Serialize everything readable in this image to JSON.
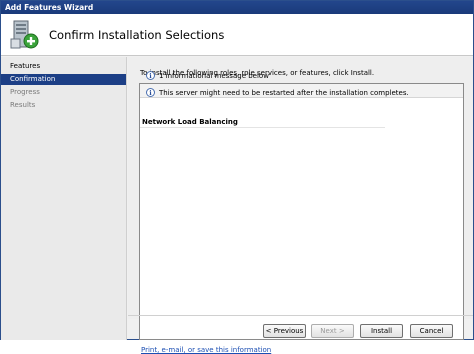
{
  "window": {
    "title": "Add Features Wizard"
  },
  "header": {
    "title": "Confirm Installation Selections",
    "icon": "server-add-icon"
  },
  "sidebar": {
    "items": [
      {
        "label": "Features",
        "state": "normal"
      },
      {
        "label": "Confirmation",
        "state": "active"
      },
      {
        "label": "Progress",
        "state": "disabled"
      },
      {
        "label": "Results",
        "state": "disabled"
      }
    ]
  },
  "main": {
    "instruction": "To install the following roles, role services, or features, click Install.",
    "summary": "1 informational message below",
    "restart_notice": "This server might need to be restarted after the installation completes.",
    "feature": "Network Load Balancing",
    "link": "Print, e-mail, or save this information"
  },
  "buttons": {
    "previous": "< Previous",
    "next": "Next >",
    "install": "Install",
    "cancel": "Cancel"
  },
  "colors": {
    "titlebar": "#1a3a7a",
    "selection": "#1c3f86",
    "link": "#1c4fb3"
  }
}
